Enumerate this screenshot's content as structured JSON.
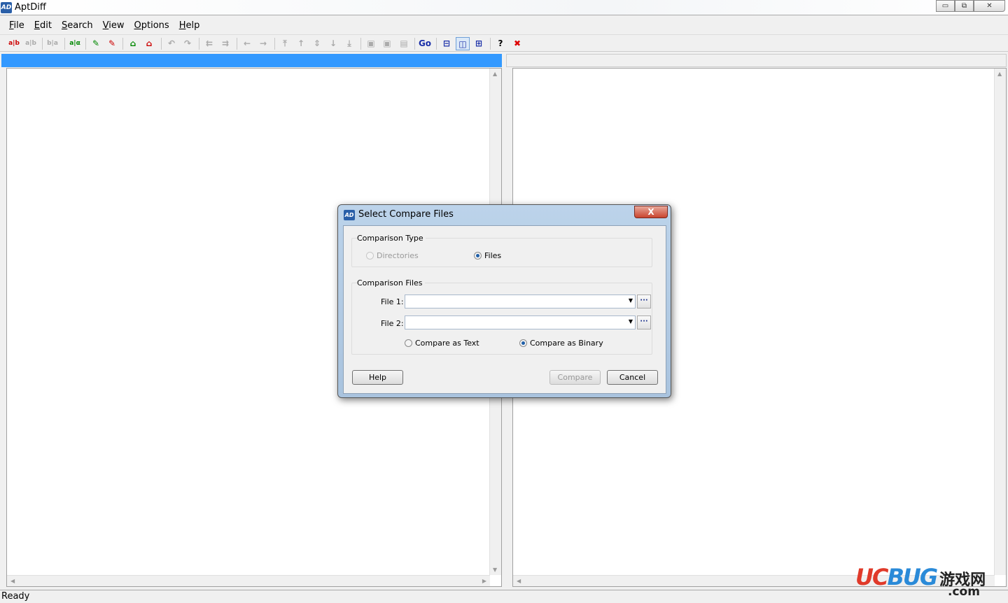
{
  "window": {
    "title": "AptDiff",
    "icon": "AD",
    "controls": [
      "minimize-icon",
      "maximize-icon",
      "close-icon"
    ]
  },
  "menu": [
    {
      "key": "F",
      "rest": "ile"
    },
    {
      "key": "E",
      "rest": "dit"
    },
    {
      "key": "S",
      "rest": "earch"
    },
    {
      "key": "V",
      "rest": "iew"
    },
    {
      "key": "O",
      "rest": "ptions"
    },
    {
      "key": "H",
      "rest": "elp"
    }
  ],
  "toolbar": [
    {
      "name": "compare-icon",
      "glyph": "a|b",
      "color": "#c00"
    },
    {
      "name": "recompare-icon",
      "glyph": "a|b",
      "color": "#aaa"
    },
    {
      "name": "swap-icon",
      "glyph": "b|a",
      "color": "#aaa",
      "sepBefore": true
    },
    {
      "name": "options-compare-icon",
      "glyph": "a|α",
      "color": "#080",
      "sepBefore": true
    },
    {
      "name": "edit-left-icon",
      "glyph": "✎",
      "color": "#080",
      "sepBefore": true
    },
    {
      "name": "edit-right-icon",
      "glyph": "✎",
      "color": "#c00"
    },
    {
      "name": "mark-left-icon",
      "glyph": "⌂",
      "color": "#080",
      "sepBefore": true
    },
    {
      "name": "mark-right-icon",
      "glyph": "⌂",
      "color": "#c00"
    },
    {
      "name": "undo-icon",
      "glyph": "↶",
      "color": "#aaa",
      "sepBefore": true
    },
    {
      "name": "redo-icon",
      "glyph": "↷",
      "color": "#aaa"
    },
    {
      "name": "copy-to-left-icon",
      "glyph": "⇇",
      "color": "#aaa",
      "sepBefore": true
    },
    {
      "name": "copy-to-right-icon",
      "glyph": "⇉",
      "color": "#aaa"
    },
    {
      "name": "arrow-left-icon",
      "glyph": "←",
      "color": "#aaa",
      "sepBefore": true
    },
    {
      "name": "arrow-right-icon",
      "glyph": "→",
      "color": "#aaa"
    },
    {
      "name": "first-diff-icon",
      "glyph": "⤒",
      "color": "#aaa",
      "sepBefore": true
    },
    {
      "name": "prev-diff-icon",
      "glyph": "↑",
      "color": "#aaa"
    },
    {
      "name": "current-diff-icon",
      "glyph": "⇕",
      "color": "#aaa"
    },
    {
      "name": "next-diff-icon",
      "glyph": "↓",
      "color": "#aaa"
    },
    {
      "name": "last-diff-icon",
      "glyph": "⤓",
      "color": "#aaa"
    },
    {
      "name": "save-left-icon",
      "glyph": "▣",
      "color": "#aaa",
      "sepBefore": true
    },
    {
      "name": "save-right-icon",
      "glyph": "▣",
      "color": "#aaa"
    },
    {
      "name": "save-all-icon",
      "glyph": "▤",
      "color": "#aaa"
    },
    {
      "name": "go-to-line-icon",
      "glyph": "Go",
      "color": "#1a2fa8",
      "sepBefore": true
    },
    {
      "name": "horizontal-layout-icon",
      "glyph": "⊟",
      "color": "#1a2fa8",
      "sepBefore": true
    },
    {
      "name": "vertical-layout-icon",
      "glyph": "◫",
      "color": "#1a2fa8",
      "active": true
    },
    {
      "name": "split-layout-icon",
      "glyph": "⊞",
      "color": "#1a2fa8"
    },
    {
      "name": "help-icon",
      "glyph": "?",
      "color": "#000",
      "sepBefore": true
    },
    {
      "name": "exit-icon",
      "glyph": "✖",
      "color": "#d00"
    }
  ],
  "status": "Ready",
  "dialog": {
    "title": "Select Compare Files",
    "icon": "AD",
    "close": "X",
    "comparison_type": {
      "label": "Comparison Type",
      "options": [
        {
          "label": "Directories",
          "selected": false,
          "disabled": true
        },
        {
          "label": "Files",
          "selected": true,
          "disabled": false
        }
      ]
    },
    "comparison_files": {
      "label": "Comparison Files",
      "file1_label": "File 1:",
      "file1_value": "",
      "file2_label": "File 2:",
      "file2_value": "",
      "browse": "···",
      "mode_options": [
        {
          "label": "Compare as Text",
          "selected": false
        },
        {
          "label": "Compare as Binary",
          "selected": true
        }
      ]
    },
    "buttons": {
      "help": "Help",
      "compare": "Compare",
      "cancel": "Cancel"
    }
  },
  "watermark": {
    "logo": "UCBUG",
    "cn": "游戏网",
    "domain": ".com"
  }
}
